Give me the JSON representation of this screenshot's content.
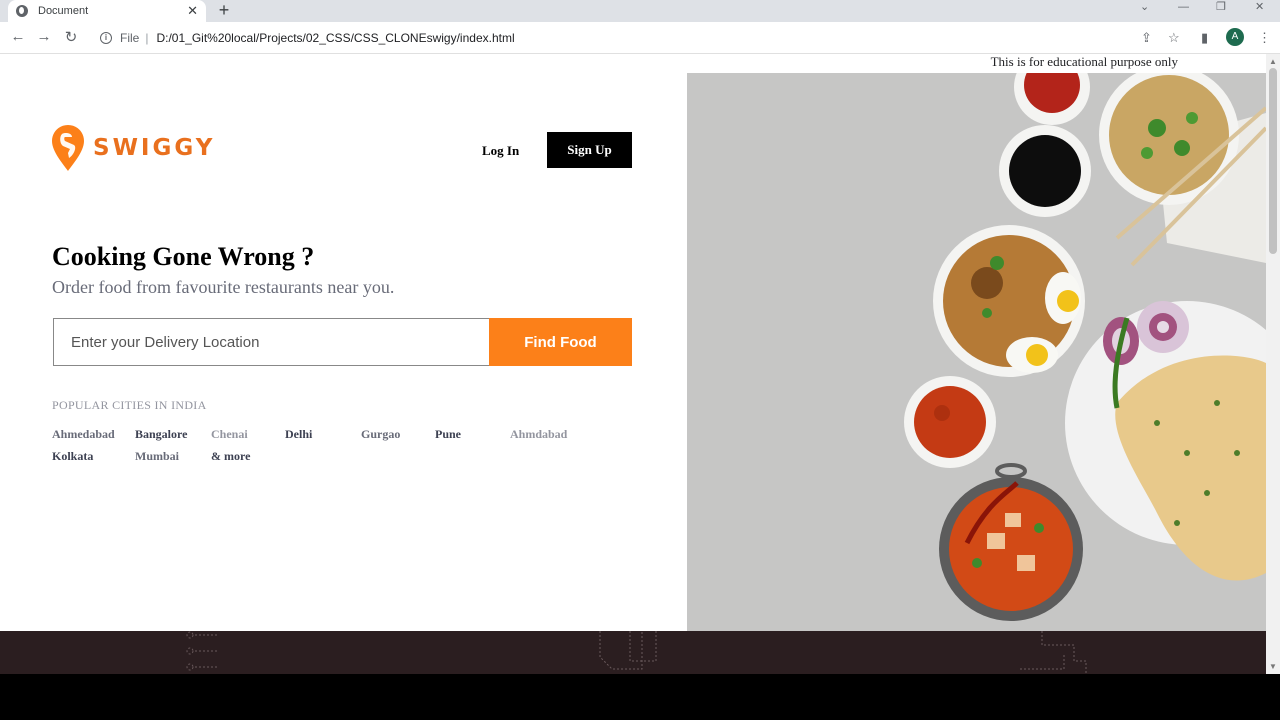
{
  "browser": {
    "tab_title": "Document",
    "tab_close": "✕",
    "new_tab": "+",
    "omnibox_prefix": "File",
    "omnibox_separator": "|",
    "url": "D:/01_Git%20local/Projects/02_CSS/CSS_CLONEswigy/index.html",
    "profile_initial": "A"
  },
  "page": {
    "notice": "This is for educational purpose only",
    "brand": "SWIGGY",
    "brand_color": "#e9701e",
    "login_label": "Log In",
    "signup_label": "Sign Up",
    "headline": "Cooking Gone Wrong ?",
    "subline": "Order food from favourite restaurants near you.",
    "search_placeholder": "Enter your Delivery Location",
    "find_food_label": "Find Food",
    "accent_color": "#fc8019",
    "popular_heading": "POPULAR CITIES IN INDIA",
    "cities": [
      {
        "name": "Ahmedabad",
        "color": "#686b78"
      },
      {
        "name": "Bangalore",
        "color": "#3d4152"
      },
      {
        "name": "Chenai",
        "color": "#93959f"
      },
      {
        "name": "Delhi",
        "color": "#3d4152"
      },
      {
        "name": "Gurgao",
        "color": "#686b78"
      },
      {
        "name": "Pune",
        "color": "#3d4152"
      },
      {
        "name": "Ahmdabad",
        "color": "#93959f"
      },
      {
        "name": "Kolkata",
        "color": "#3d4152"
      },
      {
        "name": "Mumbai",
        "color": "#686b78"
      },
      {
        "name": "& more",
        "color": "#3d4152"
      }
    ]
  }
}
